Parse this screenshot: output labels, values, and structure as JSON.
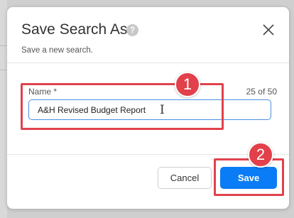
{
  "dialog": {
    "title": "Save Search As",
    "help_icon": "help-icon",
    "help_glyph": "?",
    "close_icon": "close-icon",
    "subtitle": "Save a new search."
  },
  "form": {
    "name_label": "Name *",
    "char_count": "25 of 50",
    "name_value": "A&H Revised Budget Report",
    "cursor_icon": "text-cursor-icon",
    "cursor_glyph": "I"
  },
  "footer": {
    "cancel_label": "Cancel",
    "save_label": "Save"
  },
  "annotations": {
    "step1": "1",
    "step2": "2",
    "color": "#e0424d"
  }
}
